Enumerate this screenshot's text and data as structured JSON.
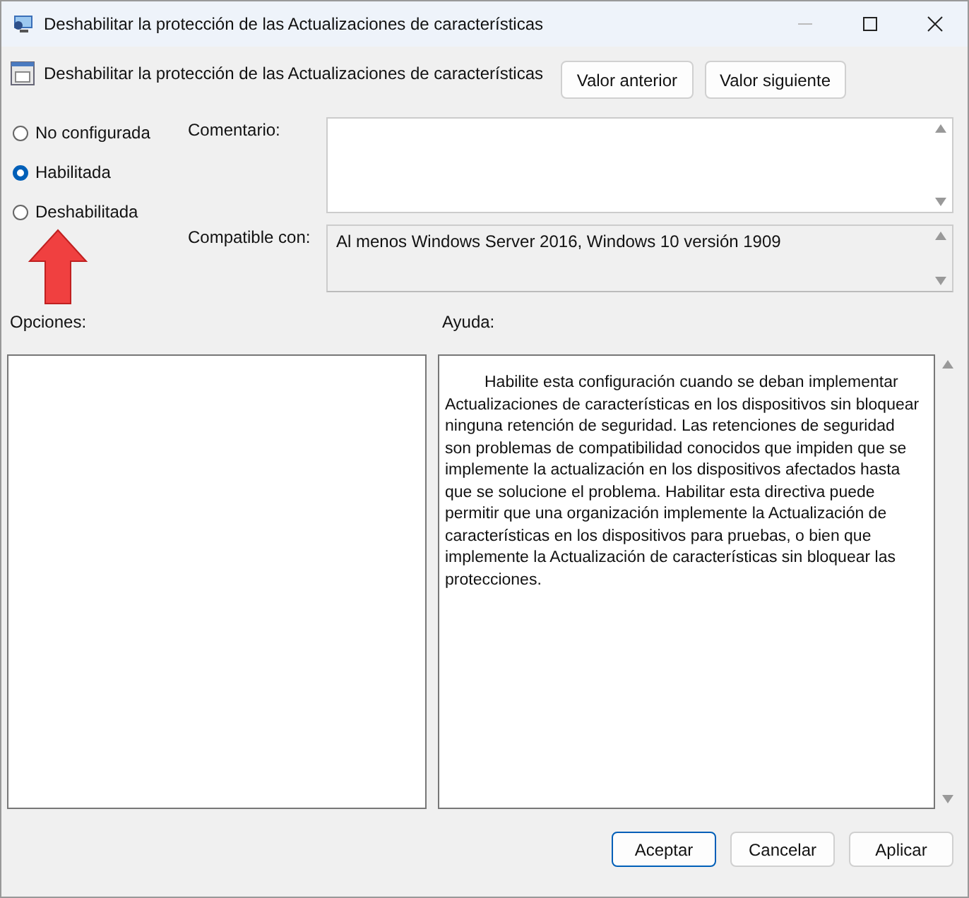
{
  "window": {
    "title": "Deshabilitar la protección de las Actualizaciones de características"
  },
  "header": {
    "policy_name": "Deshabilitar la protección de las Actualizaciones de características",
    "buttons": [
      "Valor anterior",
      "Valor siguiente"
    ]
  },
  "states": [
    {
      "label": "No configurada",
      "selected": false
    },
    {
      "label": "Habilitada",
      "selected": true
    },
    {
      "label": "Deshabilitada",
      "selected": false
    }
  ],
  "comment": {
    "label": "Comentario:"
  },
  "supported": {
    "label": "Compatible con:",
    "value": "Al menos Windows Server 2016, Windows 10 versión 1909"
  },
  "options": {
    "label": "Opciones:"
  },
  "help": {
    "label": "Ayuda:",
    "text": "Habilite esta configuración cuando se deban implementar Actualizaciones de características en los dispositivos sin bloquear ninguna retención de seguridad. Las retenciones de seguridad son problemas de compatibilidad conocidos que impiden que se implemente la actualización en los dispositivos afectados hasta que se solucione el problema. Habilitar esta directiva puede permitir que una organización implemente la Actualización de características en los dispositivos para pruebas, o bien que implemente la Actualización de características sin bloquear las protecciones."
  },
  "footer": {
    "buttons": [
      {
        "label": "Aceptar",
        "selected": true
      },
      {
        "label": "Cancelar",
        "selected": false
      },
      {
        "label": "Aplicar",
        "selected": false
      }
    ]
  }
}
